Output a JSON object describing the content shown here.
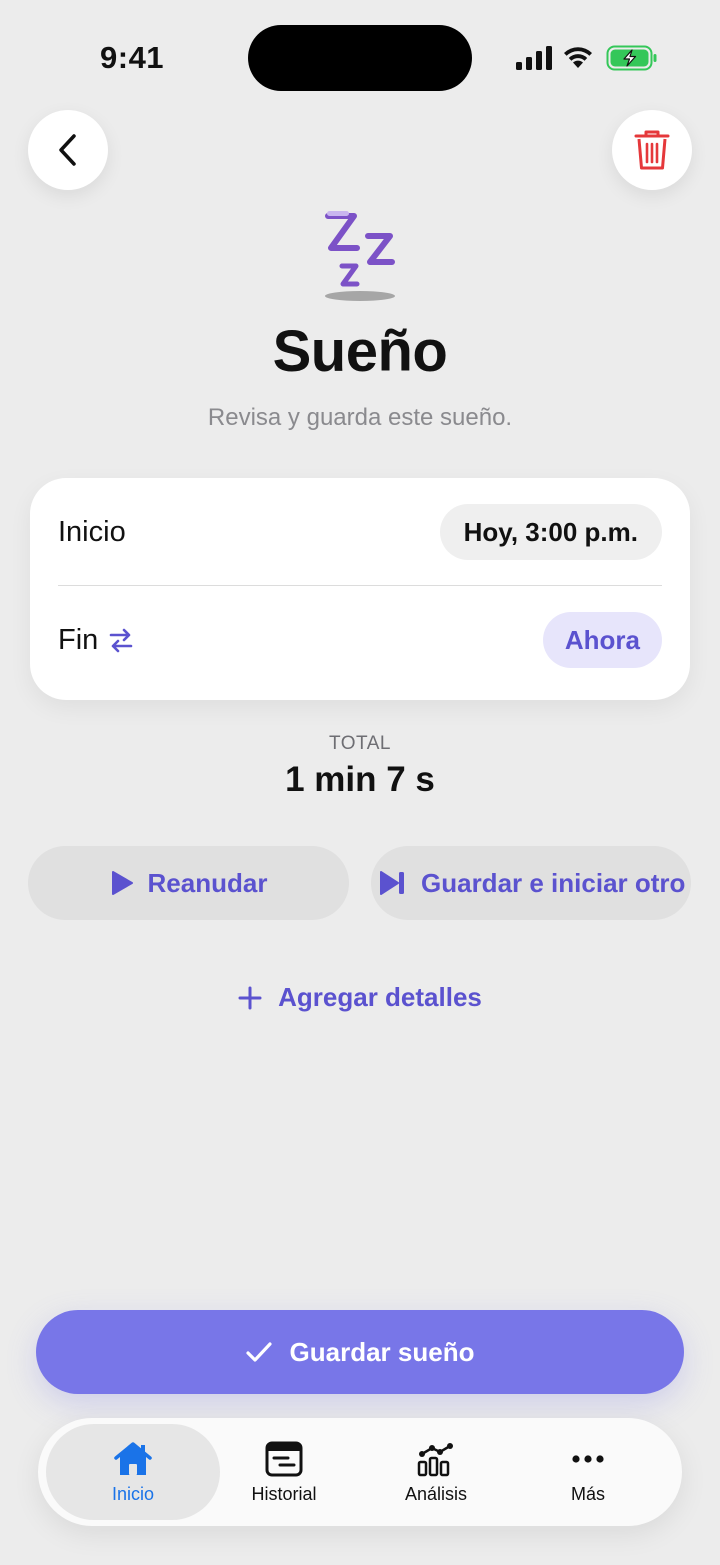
{
  "status_bar": {
    "time": "9:41"
  },
  "header": {
    "title": "Sueño",
    "subtitle": "Revisa y guarda este sueño."
  },
  "card": {
    "start_label": "Inicio",
    "start_value": "Hoy, 3:00 p.m.",
    "end_label": "Fin",
    "end_value": "Ahora"
  },
  "total": {
    "label": "TOTAL",
    "value": "1 min 7 s"
  },
  "actions": {
    "resume_label": "Reanudar",
    "save_new_label": "Guardar e iniciar otro",
    "add_details_label": "Agregar detalles",
    "save_label": "Guardar sueño"
  },
  "tabs": [
    {
      "label": "Inicio",
      "icon": "house-icon",
      "active": true
    },
    {
      "label": "Historial",
      "icon": "history-icon",
      "active": false
    },
    {
      "label": "Análisis",
      "icon": "analytics-icon",
      "active": false
    },
    {
      "label": "Más",
      "icon": "more-icon",
      "active": false
    }
  ],
  "colors": {
    "accent": "#5b52cf",
    "primary_button": "#7876e8",
    "delete": "#e5383b",
    "active_tab": "#1a73e8",
    "battery": "#34c759"
  }
}
